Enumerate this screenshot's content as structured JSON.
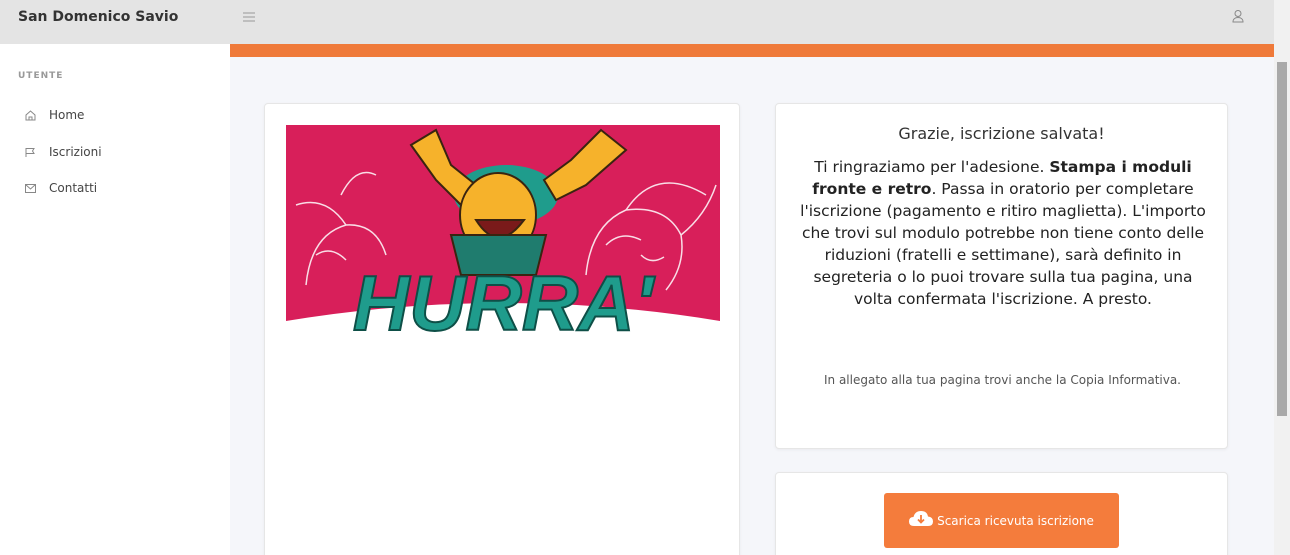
{
  "header": {
    "brand": "San Domenico Savio",
    "menu_icon": "hamburger-icon",
    "user_icon": "user-icon"
  },
  "sidebar": {
    "section": "UTENTE",
    "items": [
      {
        "label": "Home",
        "icon": "home-icon"
      },
      {
        "label": "Iscrizioni",
        "icon": "flag-icon"
      },
      {
        "label": "Contatti",
        "icon": "mail-icon"
      }
    ]
  },
  "banner": {
    "logo_text": "HURRA'"
  },
  "message": {
    "title": "Grazie, iscrizione salvata!",
    "body_pre": "Ti ringraziamo per l'adesione. ",
    "body_bold": "Stampa i moduli fronte e retro",
    "body_post": ". Passa in oratorio per completare l'iscrizione (pagamento e ritiro maglietta). L'importo che trovi sul modulo potrebbe non tiene conto delle riduzioni (fratelli e settimane), sarà definito in segreteria o lo puoi trovare sulla tua pagina, una volta confermata l'iscrizione. A presto.",
    "note": "In allegato alla tua pagina trovi anche la Copia Informativa."
  },
  "download": {
    "label": "Scarica ricevuta iscrizione",
    "icon": "cloud-download-icon"
  },
  "colors": {
    "accent": "#ef7a3a",
    "button": "#f47c3c",
    "banner_bg": "#d81f5a",
    "logo_text": "#1f9c8c"
  }
}
